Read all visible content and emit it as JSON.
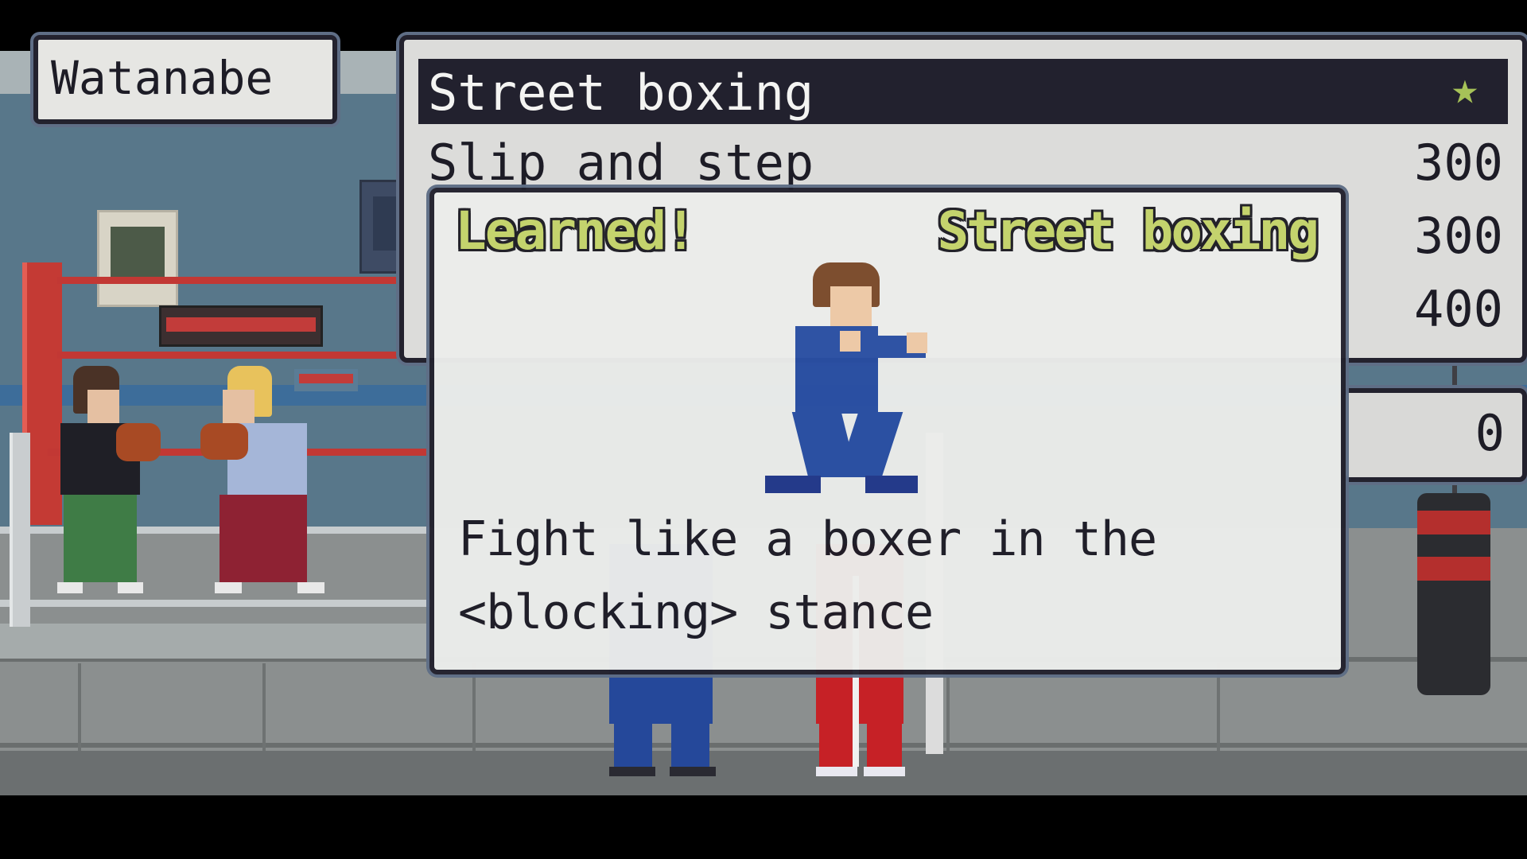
{
  "character": {
    "name": "Watanabe"
  },
  "style_list": {
    "selected": {
      "label": "Street boxing",
      "icon": "star-icon",
      "icon_color": "#a6c258"
    },
    "rows": [
      {
        "label": "Slip and step",
        "cost": "300"
      },
      {
        "label": "",
        "cost": "300"
      },
      {
        "label": "",
        "cost": "400"
      }
    ]
  },
  "sp": {
    "value": "0"
  },
  "popup": {
    "status": "Learned!",
    "style_name": "Street boxing",
    "description": "Fight like a boxer in the <blocking> stance",
    "highlight_color": "#c4d36a"
  }
}
